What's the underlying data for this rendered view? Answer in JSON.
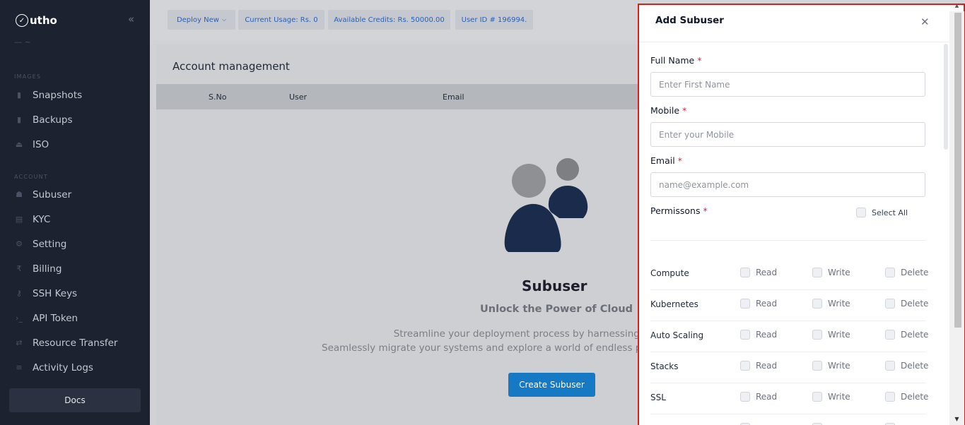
{
  "sidebar": {
    "brand": "utho",
    "sections": {
      "images": "IMAGES",
      "account": "ACCOUNT"
    },
    "image_items": [
      {
        "label": "Snapshots",
        "icon": "snapshot-icon"
      },
      {
        "label": "Backups",
        "icon": "backup-icon"
      },
      {
        "label": "ISO",
        "icon": "disc-icon"
      }
    ],
    "account_items": [
      {
        "label": "Subuser",
        "icon": "users-icon"
      },
      {
        "label": "KYC",
        "icon": "id-card-icon"
      },
      {
        "label": "Setting",
        "icon": "gear-icon"
      },
      {
        "label": "Billing",
        "icon": "rupee-icon"
      },
      {
        "label": "SSH Keys",
        "icon": "key-icon"
      },
      {
        "label": "API Token",
        "icon": "terminal-icon"
      },
      {
        "label": "Resource Transfer",
        "icon": "transfer-icon"
      },
      {
        "label": "Activity Logs",
        "icon": "logs-icon"
      }
    ],
    "docs": "Docs"
  },
  "topbar": {
    "deploy": "Deploy New",
    "usage": "Current Usage: Rs. 0",
    "credits": "Available Credits: Rs. 50000.00",
    "user_id": "User ID # 196994."
  },
  "page": {
    "title": "Account management",
    "columns": [
      "S.No",
      "User",
      "Email"
    ],
    "empty_title": "Subuser",
    "empty_subtitle": "Unlock the Power of Cloud",
    "empty_desc_1": "Streamline your deployment process by harnessing the",
    "empty_desc_2": "Seamlessly migrate your systems and explore a world of endless po",
    "create_button": "Create Subuser"
  },
  "drawer": {
    "title": "Add Subuser",
    "full_name_label": "Full Name",
    "full_name_placeholder": "Enter First Name",
    "mobile_label": "Mobile",
    "mobile_placeholder": "Enter your Mobile",
    "email_label": "Email",
    "email_placeholder": "name@example.com",
    "permissions_label": "Permissons",
    "required_mark": "*",
    "select_all": "Select All",
    "option_labels": [
      "Read",
      "Write",
      "Delete"
    ],
    "permissions": [
      {
        "name": "Compute"
      },
      {
        "name": "Kubernetes"
      },
      {
        "name": "Auto Scaling"
      },
      {
        "name": "Stacks"
      },
      {
        "name": "SSL"
      }
    ]
  },
  "colors": {
    "sidebar_bg": "#1d2230",
    "accent": "#1579c4",
    "drawer_border": "#e11a1a",
    "required": "#e11d48"
  }
}
